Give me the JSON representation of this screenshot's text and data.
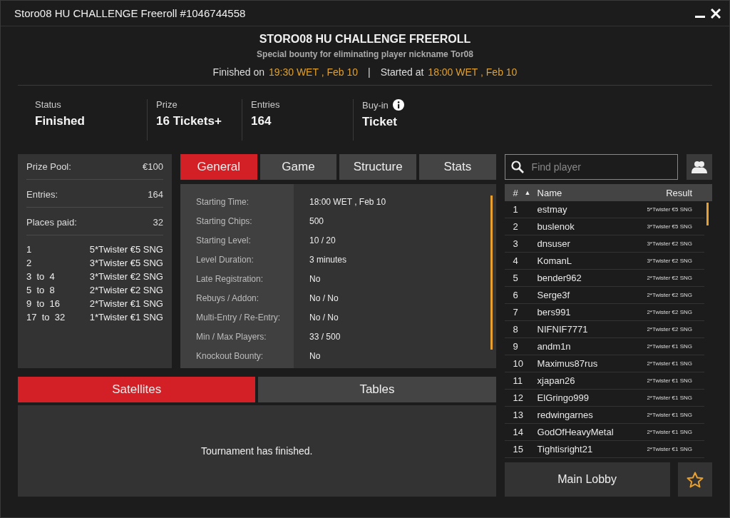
{
  "window": {
    "title": "Storo08 HU CHALLENGE Freeroll #1046744558"
  },
  "header": {
    "title": "STORO08 HU CHALLENGE FREEROLL",
    "subtitle": "Special bounty for eliminating player nickname Tor08",
    "finished_label": "Finished on",
    "finished_time": "19:30 WET , Feb 10",
    "separator": "|",
    "started_label": "Started at",
    "started_time": "18:00 WET , Feb 10"
  },
  "stats": [
    {
      "label": "Status",
      "value": "Finished",
      "info": false
    },
    {
      "label": "Prize",
      "value": "16 Tickets+",
      "info": false
    },
    {
      "label": "Entries",
      "value": "164",
      "info": false
    },
    {
      "label": "Buy-in",
      "value": "Ticket",
      "info": true
    }
  ],
  "prize_pool": {
    "summary": [
      {
        "label": "Prize Pool:",
        "value": "€100"
      },
      {
        "label": "Entries:",
        "value": "164"
      },
      {
        "label": "Places paid:",
        "value": "32"
      }
    ],
    "payouts": [
      {
        "places": "1",
        "prize": "5*Twister €5 SNG"
      },
      {
        "places": "2",
        "prize": "3*Twister €5 SNG"
      },
      {
        "places": "3  to  4",
        "prize": "3*Twister €2 SNG"
      },
      {
        "places": "5  to  8",
        "prize": "2*Twister €2 SNG"
      },
      {
        "places": "9  to  16",
        "prize": "2*Twister €1 SNG"
      },
      {
        "places": "17  to  32",
        "prize": "1*Twister €1 SNG"
      }
    ]
  },
  "tabs": [
    {
      "label": "General",
      "selected": true
    },
    {
      "label": "Game",
      "selected": false
    },
    {
      "label": "Structure",
      "selected": false
    },
    {
      "label": "Stats",
      "selected": false
    }
  ],
  "details": [
    {
      "label": "Starting Time:",
      "value": "18:00 WET , Feb 10"
    },
    {
      "label": "Starting Chips:",
      "value": "500"
    },
    {
      "label": "Starting Level:",
      "value": "10 / 20"
    },
    {
      "label": "Level Duration:",
      "value": "3 minutes"
    },
    {
      "label": "Late Registration:",
      "value": "No"
    },
    {
      "label": "Rebuys / Addon:",
      "value": "No / No"
    },
    {
      "label": "Multi-Entry / Re-Entry:",
      "value": "No / No"
    },
    {
      "label": "Min / Max Players:",
      "value": "33 / 500"
    },
    {
      "label": "Knockout Bounty:",
      "value": "No"
    }
  ],
  "bottom_tabs": [
    {
      "label": "Satellites",
      "selected": true
    },
    {
      "label": "Tables",
      "selected": false
    }
  ],
  "bottom_message": "Tournament has finished.",
  "search": {
    "placeholder": "Find player"
  },
  "players": {
    "columns": [
      "#",
      "▲",
      "Name",
      "Result"
    ],
    "rows": [
      {
        "rank": "1",
        "name": "estmay",
        "result": "5*Twister €5 SNG"
      },
      {
        "rank": "2",
        "name": "buslenok",
        "result": "3*Twister €5 SNG"
      },
      {
        "rank": "3",
        "name": "dnsuser",
        "result": "3*Twister €2 SNG"
      },
      {
        "rank": "4",
        "name": "KomanL",
        "result": "3*Twister €2 SNG"
      },
      {
        "rank": "5",
        "name": "bender962",
        "result": "2*Twister €2 SNG"
      },
      {
        "rank": "6",
        "name": "Serge3f",
        "result": "2*Twister €2 SNG"
      },
      {
        "rank": "7",
        "name": "bers991",
        "result": "2*Twister €2 SNG"
      },
      {
        "rank": "8",
        "name": "NIFNIF7771",
        "result": "2*Twister €2 SNG"
      },
      {
        "rank": "9",
        "name": "andm1n",
        "result": "2*Twister €1 SNG"
      },
      {
        "rank": "10",
        "name": "Maximus87rus",
        "result": "2*Twister €1 SNG"
      },
      {
        "rank": "11",
        "name": "xjapan26",
        "result": "2*Twister €1 SNG"
      },
      {
        "rank": "12",
        "name": "ElGringo999",
        "result": "2*Twister €1 SNG"
      },
      {
        "rank": "13",
        "name": "redwingarnes",
        "result": "2*Twister €1 SNG"
      },
      {
        "rank": "14",
        "name": "GodOfHeavyMetal",
        "result": "2*Twister €1 SNG"
      },
      {
        "rank": "15",
        "name": "Tightisright21",
        "result": "2*Twister €1 SNG"
      }
    ]
  },
  "main_lobby_button": "Main Lobby"
}
